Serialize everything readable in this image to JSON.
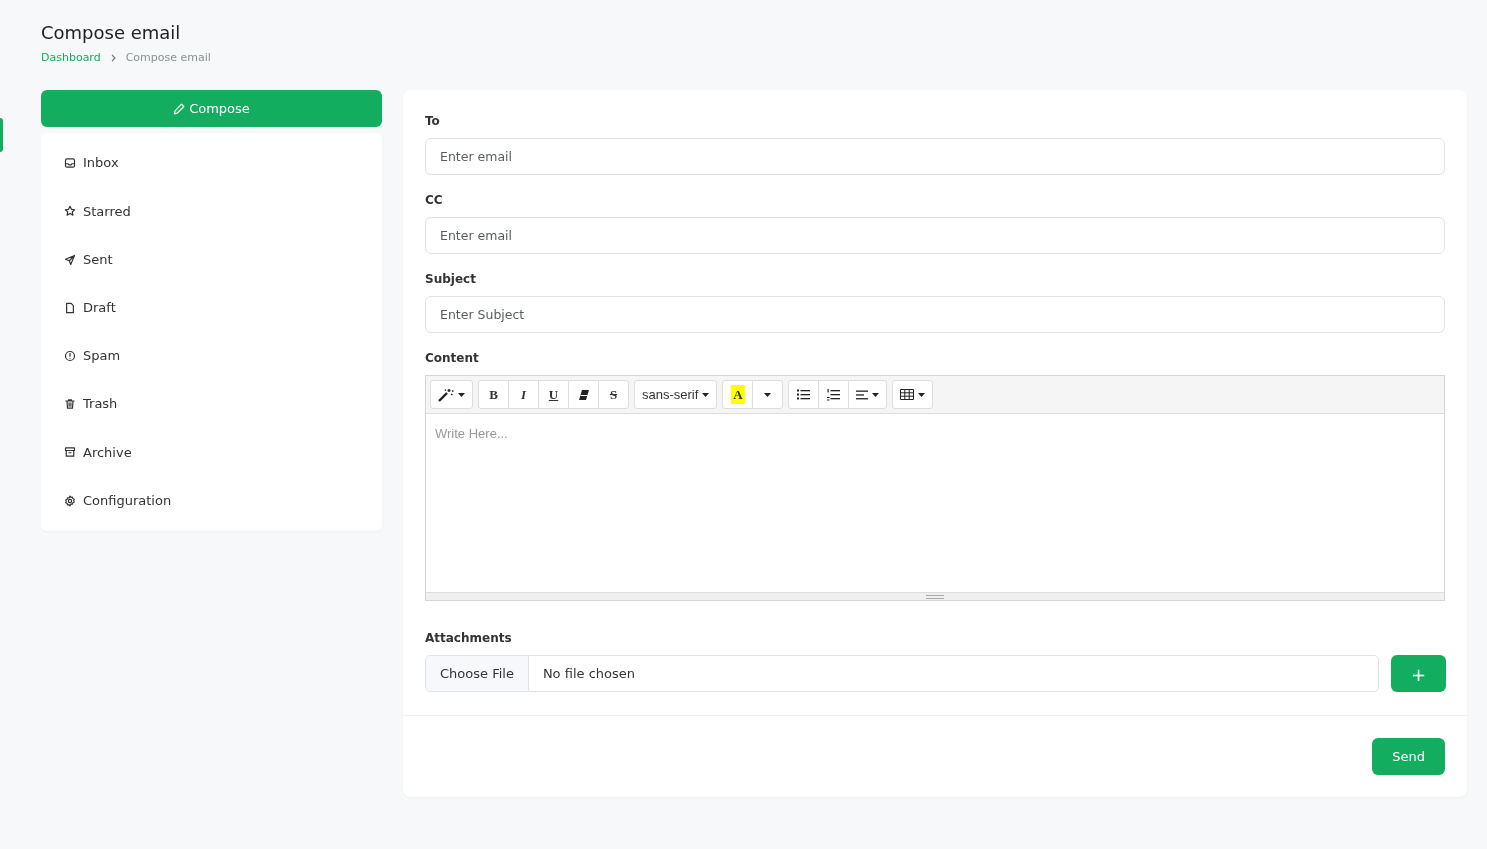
{
  "page": {
    "title": "Compose email",
    "breadcrumb": [
      {
        "label": "Dashboard",
        "kind": "link"
      },
      {
        "label": "Compose email",
        "kind": "current"
      }
    ]
  },
  "sidebar": {
    "compose_button": "Compose",
    "items": [
      {
        "label": "Inbox"
      },
      {
        "label": "Starred"
      },
      {
        "label": "Sent"
      },
      {
        "label": "Draft"
      },
      {
        "label": "Spam"
      },
      {
        "label": "Trash"
      },
      {
        "label": "Archive"
      },
      {
        "label": "Configuration"
      }
    ]
  },
  "form": {
    "fields": [
      {
        "label": "To",
        "placeholder": "Enter email"
      },
      {
        "label": "CC",
        "placeholder": "Enter email"
      },
      {
        "label": "Subject",
        "placeholder": "Enter Subject"
      }
    ],
    "content": {
      "label": "Content",
      "placeholder": "Write Here...",
      "toolbar": [
        [
          {
            "kind": "magic"
          }
        ],
        [
          {
            "kind": "bold",
            "label": "B"
          },
          {
            "kind": "italic",
            "label": "I"
          },
          {
            "kind": "underline",
            "label": "U"
          },
          {
            "kind": "eraser"
          },
          {
            "kind": "strike",
            "label": "S"
          }
        ],
        [
          {
            "kind": "font",
            "label": "sans-serif"
          }
        ],
        [
          {
            "kind": "highlight",
            "label": "A"
          },
          {
            "kind": "colormenu"
          }
        ],
        [
          {
            "kind": "bullets"
          },
          {
            "kind": "numbers"
          },
          {
            "kind": "align"
          }
        ],
        [
          {
            "kind": "table"
          }
        ]
      ]
    },
    "attachments": {
      "label": "Attachments",
      "button": "Choose File",
      "status": "No file chosen",
      "add_button": "+"
    },
    "send_button": "Send"
  }
}
